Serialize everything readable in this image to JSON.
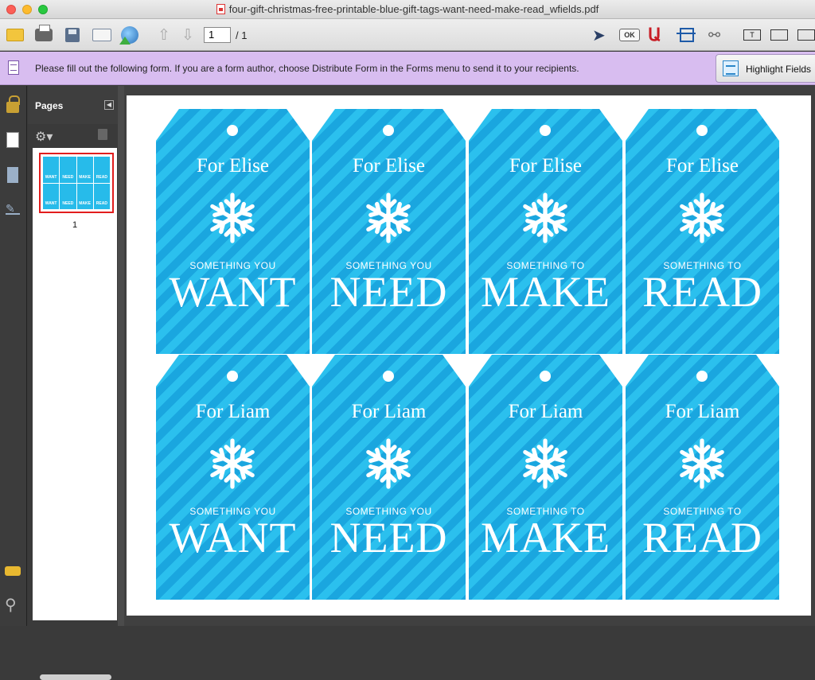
{
  "window": {
    "title": "four-gift-christmas-free-printable-blue-gift-tags-want-need-make-read_wfields.pdf"
  },
  "toolbar": {
    "page_number": "1",
    "page_total": "/ 1",
    "ok_label": "OK",
    "text_field_label": "T"
  },
  "form_bar": {
    "message": "Please fill out the following form. If you are a form author, choose Distribute Form in the Forms menu to send it to your recipients.",
    "highlight_label": "Highlight Fields"
  },
  "pages_panel": {
    "title": "Pages",
    "thumbnail_label": "1",
    "thumb_mini": [
      "WANT",
      "NEED",
      "MAKE",
      "READ",
      "WANT",
      "NEED",
      "MAKE",
      "READ"
    ]
  },
  "tags": [
    {
      "name": "For Elise",
      "subtitle": "SOMETHING YOU",
      "word": "WANT"
    },
    {
      "name": "For Elise",
      "subtitle": "SOMETHING YOU",
      "word": "NEED"
    },
    {
      "name": "For Elise",
      "subtitle": "SOMETHING TO",
      "word": "MAKE"
    },
    {
      "name": "For Elise",
      "subtitle": "SOMETHING TO",
      "word": "READ"
    },
    {
      "name": "For Liam",
      "subtitle": "SOMETHING YOU",
      "word": "WANT"
    },
    {
      "name": "For Liam",
      "subtitle": "SOMETHING YOU",
      "word": "NEED"
    },
    {
      "name": "For Liam",
      "subtitle": "SOMETHING TO",
      "word": "MAKE"
    },
    {
      "name": "For Liam",
      "subtitle": "SOMETHING TO",
      "word": "READ"
    }
  ],
  "colors": {
    "tag_light": "#2bc0ee",
    "tag_dark": "#1aa6df",
    "form_bar": "#d8bdf0"
  }
}
